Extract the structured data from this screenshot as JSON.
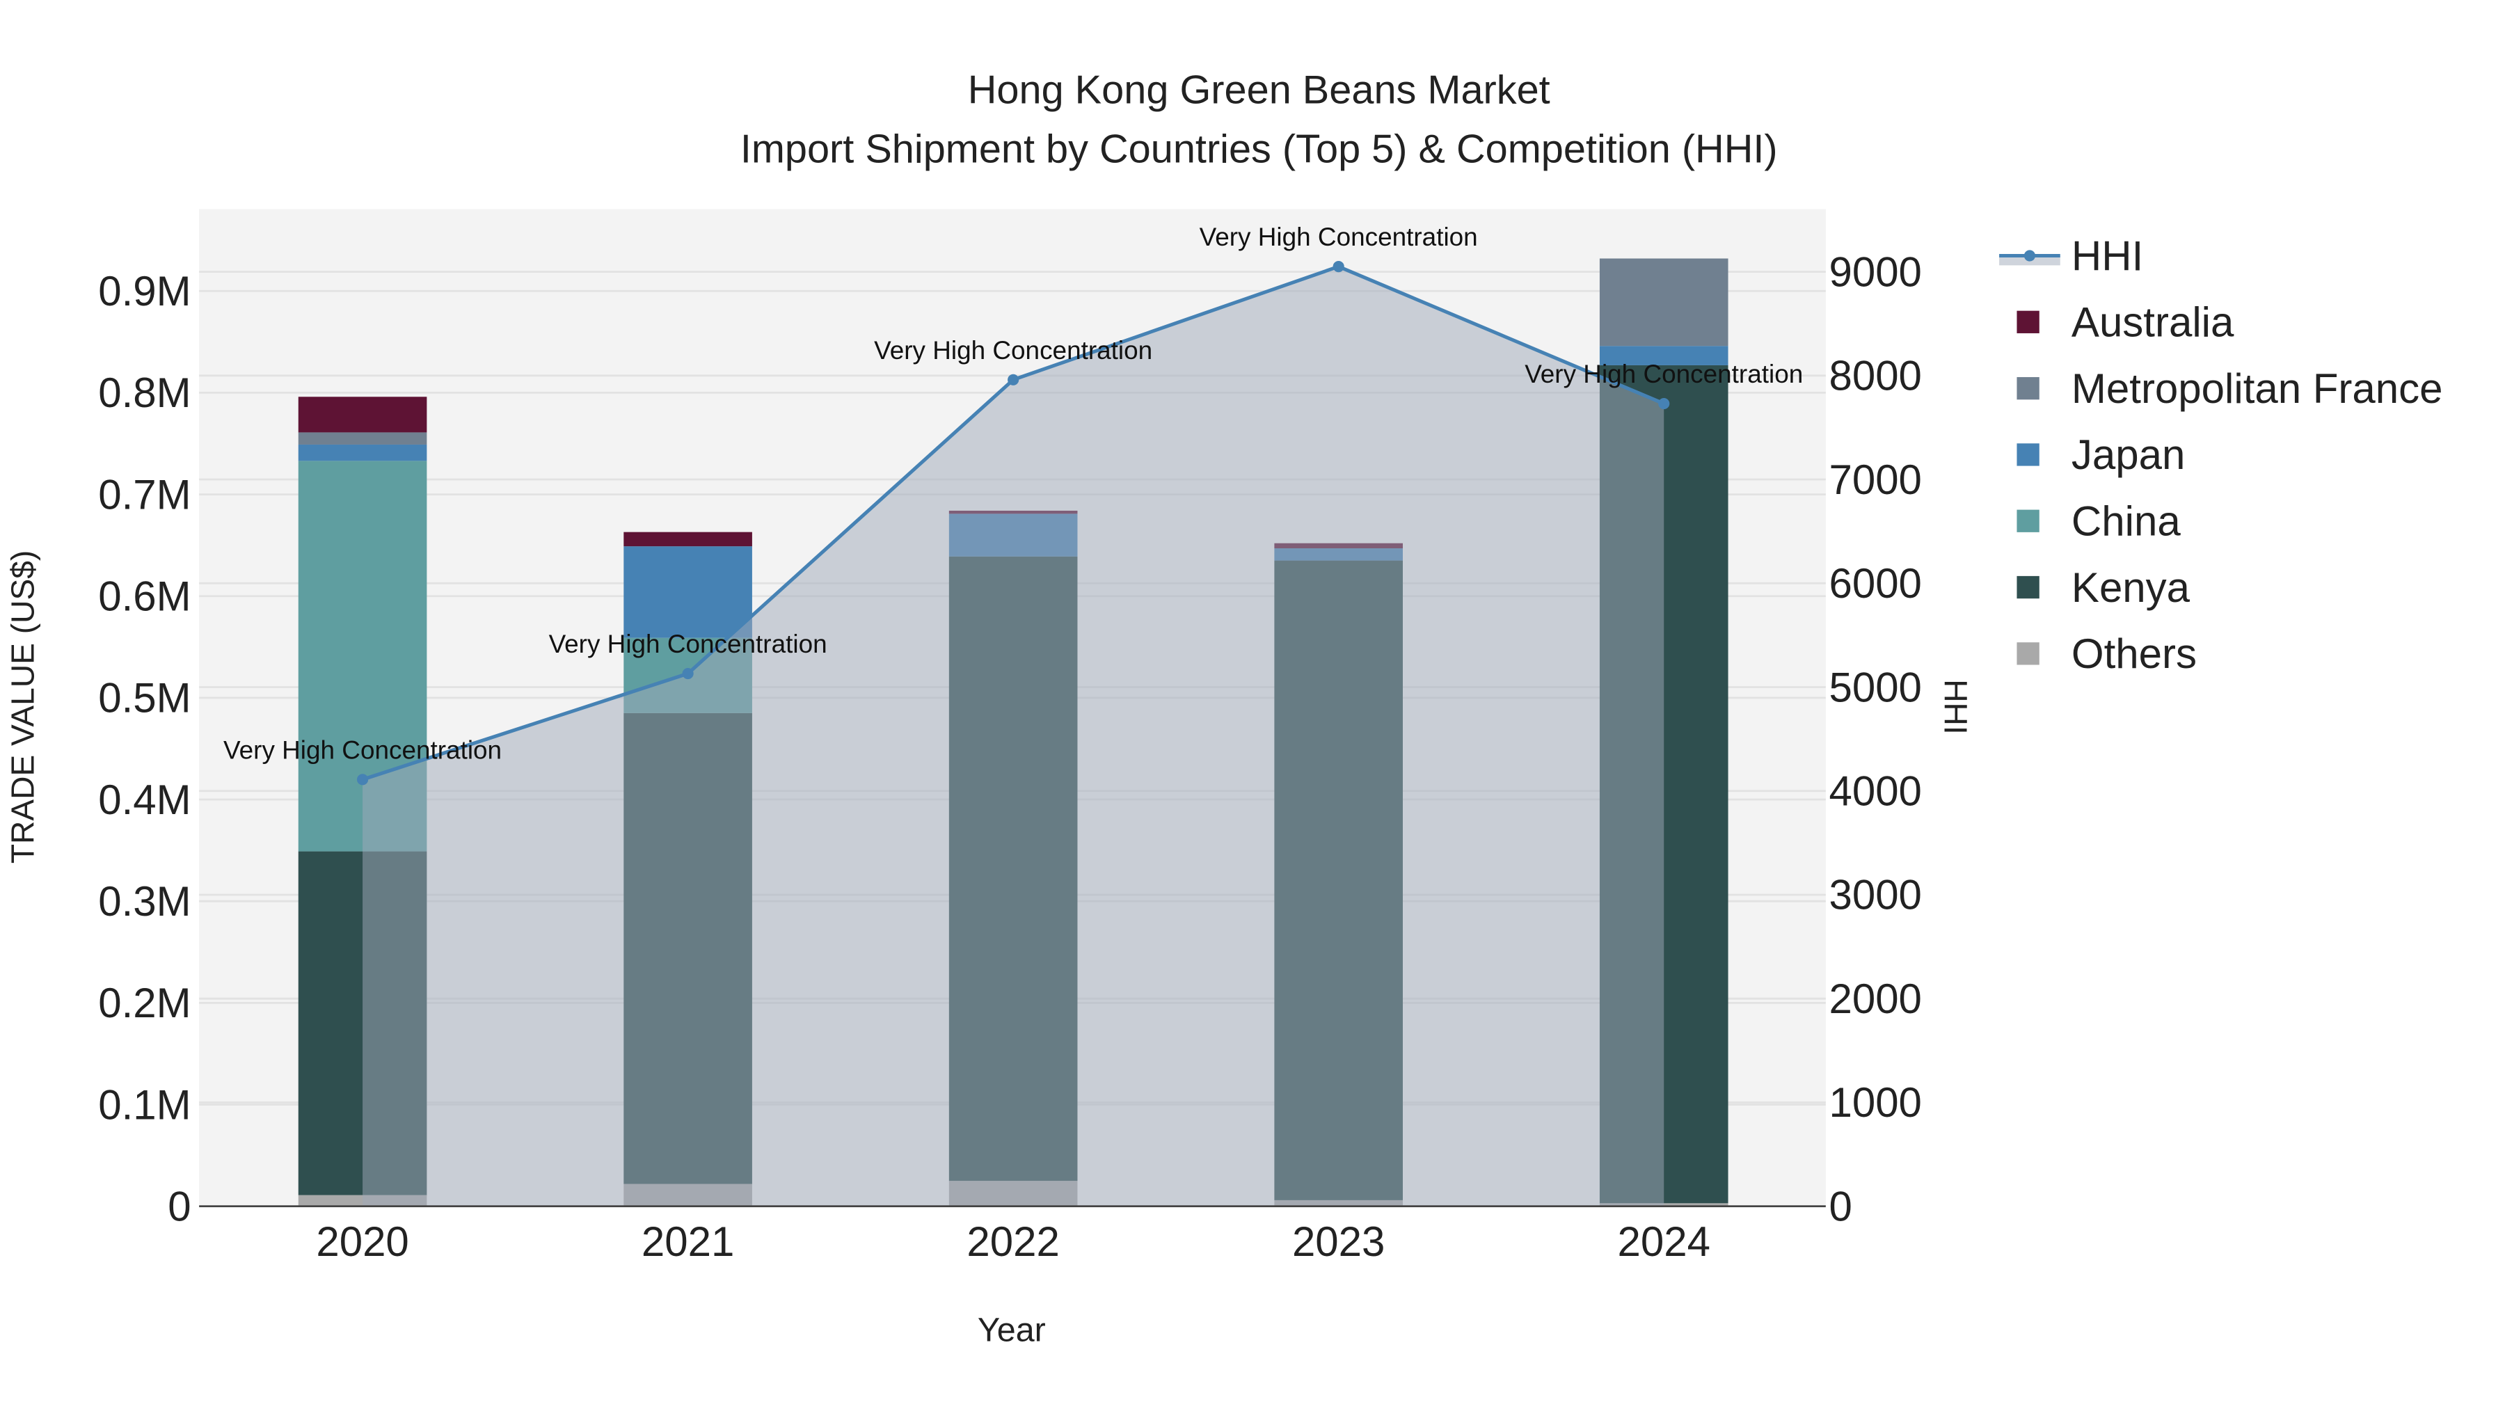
{
  "chart_data": {
    "type": "bar",
    "title": "Hong Kong Green Beans Market",
    "subtitle": "Import Shipment by Countries (Top 5) & Competition (HHI)",
    "xlabel": "Year",
    "ylabel": "TRADE VALUE (US$)",
    "y2label": "HHI",
    "categories": [
      "2020",
      "2021",
      "2022",
      "2023",
      "2024"
    ],
    "ylim": [
      0,
      0.98
    ],
    "y_unit": "millions US$",
    "y_ticks": [
      0,
      0.1,
      0.2,
      0.3,
      0.4,
      0.5,
      0.6,
      0.7,
      0.8,
      0.9
    ],
    "y_tick_labels": [
      "0",
      "0.1M",
      "0.2M",
      "0.3M",
      "0.4M",
      "0.5M",
      "0.6M",
      "0.7M",
      "0.8M",
      "0.9M"
    ],
    "y2lim": [
      0,
      9600
    ],
    "y2_ticks": [
      0,
      1000,
      2000,
      3000,
      4000,
      5000,
      6000,
      7000,
      8000,
      9000
    ],
    "y2_tick_labels": [
      "0",
      "1000",
      "2000",
      "3000",
      "4000",
      "5000",
      "6000",
      "7000",
      "8000",
      "9000"
    ],
    "stack_order": [
      "Others",
      "Kenya",
      "China",
      "Japan",
      "Metropolitan France",
      "Australia"
    ],
    "series": [
      {
        "name": "Others",
        "color": "#A9A9A9",
        "values": [
          0.011,
          0.022,
          0.025,
          0.006,
          0.003
        ]
      },
      {
        "name": "Kenya",
        "color": "#2F4F4F",
        "values": [
          0.338,
          0.463,
          0.614,
          0.629,
          0.824
        ]
      },
      {
        "name": "China",
        "color": "#5F9EA0",
        "values": [
          0.384,
          0.074,
          0,
          0,
          0
        ]
      },
      {
        "name": "Japan",
        "color": "#4682B4",
        "values": [
          0.016,
          0.09,
          0.042,
          0.012,
          0.019
        ]
      },
      {
        "name": "Metropolitan France",
        "color": "#708090",
        "values": [
          0.012,
          0,
          0,
          0,
          0.086
        ]
      },
      {
        "name": "Australia",
        "color": "#5E1334",
        "values": [
          0.035,
          0.014,
          0.003,
          0.005,
          0
        ]
      }
    ],
    "hhi": {
      "name": "HHI",
      "color": "#4682B4",
      "values": [
        4110,
        5130,
        7960,
        9050,
        7730
      ],
      "annotations": [
        "Very High Concentration",
        "Very High Concentration",
        "Very High Concentration",
        "Very High Concentration",
        "Very High Concentration"
      ]
    },
    "legend": [
      "HHI",
      "Australia",
      "Metropolitan France",
      "Japan",
      "China",
      "Kenya",
      "Others"
    ],
    "legend_position": "right",
    "grid": true
  }
}
